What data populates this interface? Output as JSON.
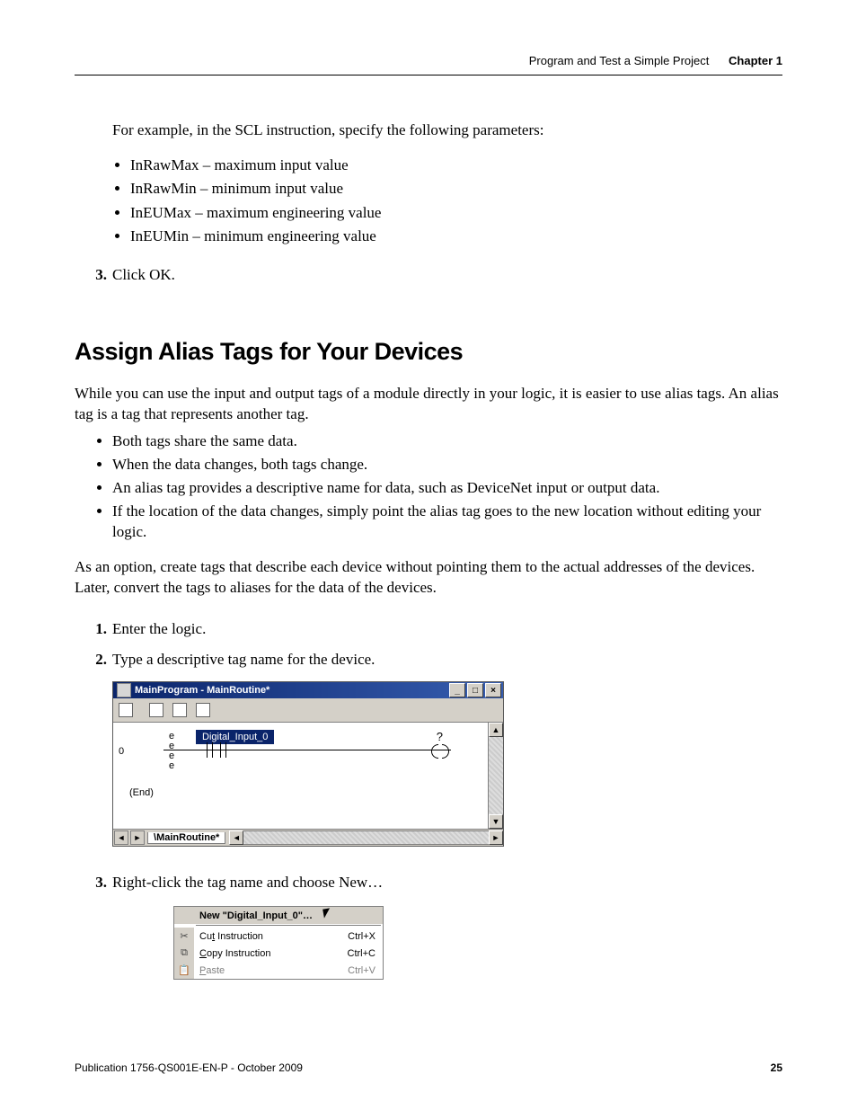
{
  "header": {
    "section_title": "Program and Test a Simple Project",
    "chapter_label": "Chapter 1"
  },
  "intro": "For example, in the SCL instruction, specify the following parameters:",
  "params": [
    "InRawMax – maximum input value",
    "InRawMin – minimum input value",
    "InEUMax – maximum engineering value",
    "InEUMin – minimum engineering value"
  ],
  "step3_num": "3.",
  "step3_text": "Click OK.",
  "h2": "Assign Alias Tags for Your Devices",
  "para1": "While you can use the input and output tags of a module directly in your logic, it is easier to use alias tags. An alias tag is a tag that represents another tag.",
  "bullets": [
    "Both tags share the same data.",
    "When the data changes, both tags change.",
    "An alias tag provides a descriptive name for data, such as DeviceNet input or output data.",
    "If the location of the data changes, simply point the alias tag goes to the new location without editing your logic."
  ],
  "para2": "As an option, create tags that describe each device without pointing them to the actual addresses of the devices. Later, convert the tags to aliases for the data of the devices.",
  "steps": {
    "s1_num": "1.",
    "s1_text": "Enter the logic.",
    "s2_num": "2.",
    "s2_text": "Type a descriptive tag name for the device.",
    "s3_num": "3.",
    "s3_text": "Right-click the tag name and choose New…"
  },
  "ladder": {
    "title": "MainProgram - MainRoutine*",
    "rung_num": "0",
    "e_col": "e\ne\ne\ne",
    "tag": "Digital_Input_0",
    "end": "(End)",
    "qmark": "?",
    "tab": "MainRoutine* "
  },
  "menu": {
    "new_label": "New \"Digital_Input_0\"…",
    "cut_label": "Cut Instruction",
    "cut_accel": "Ctrl+X",
    "copy_label": "Copy Instruction",
    "copy_accel": "Ctrl+C",
    "paste_label": "Paste",
    "paste_accel": "Ctrl+V"
  },
  "footer": {
    "pub": "Publication 1756-QS001E-EN-P - October 2009",
    "page": "25"
  }
}
